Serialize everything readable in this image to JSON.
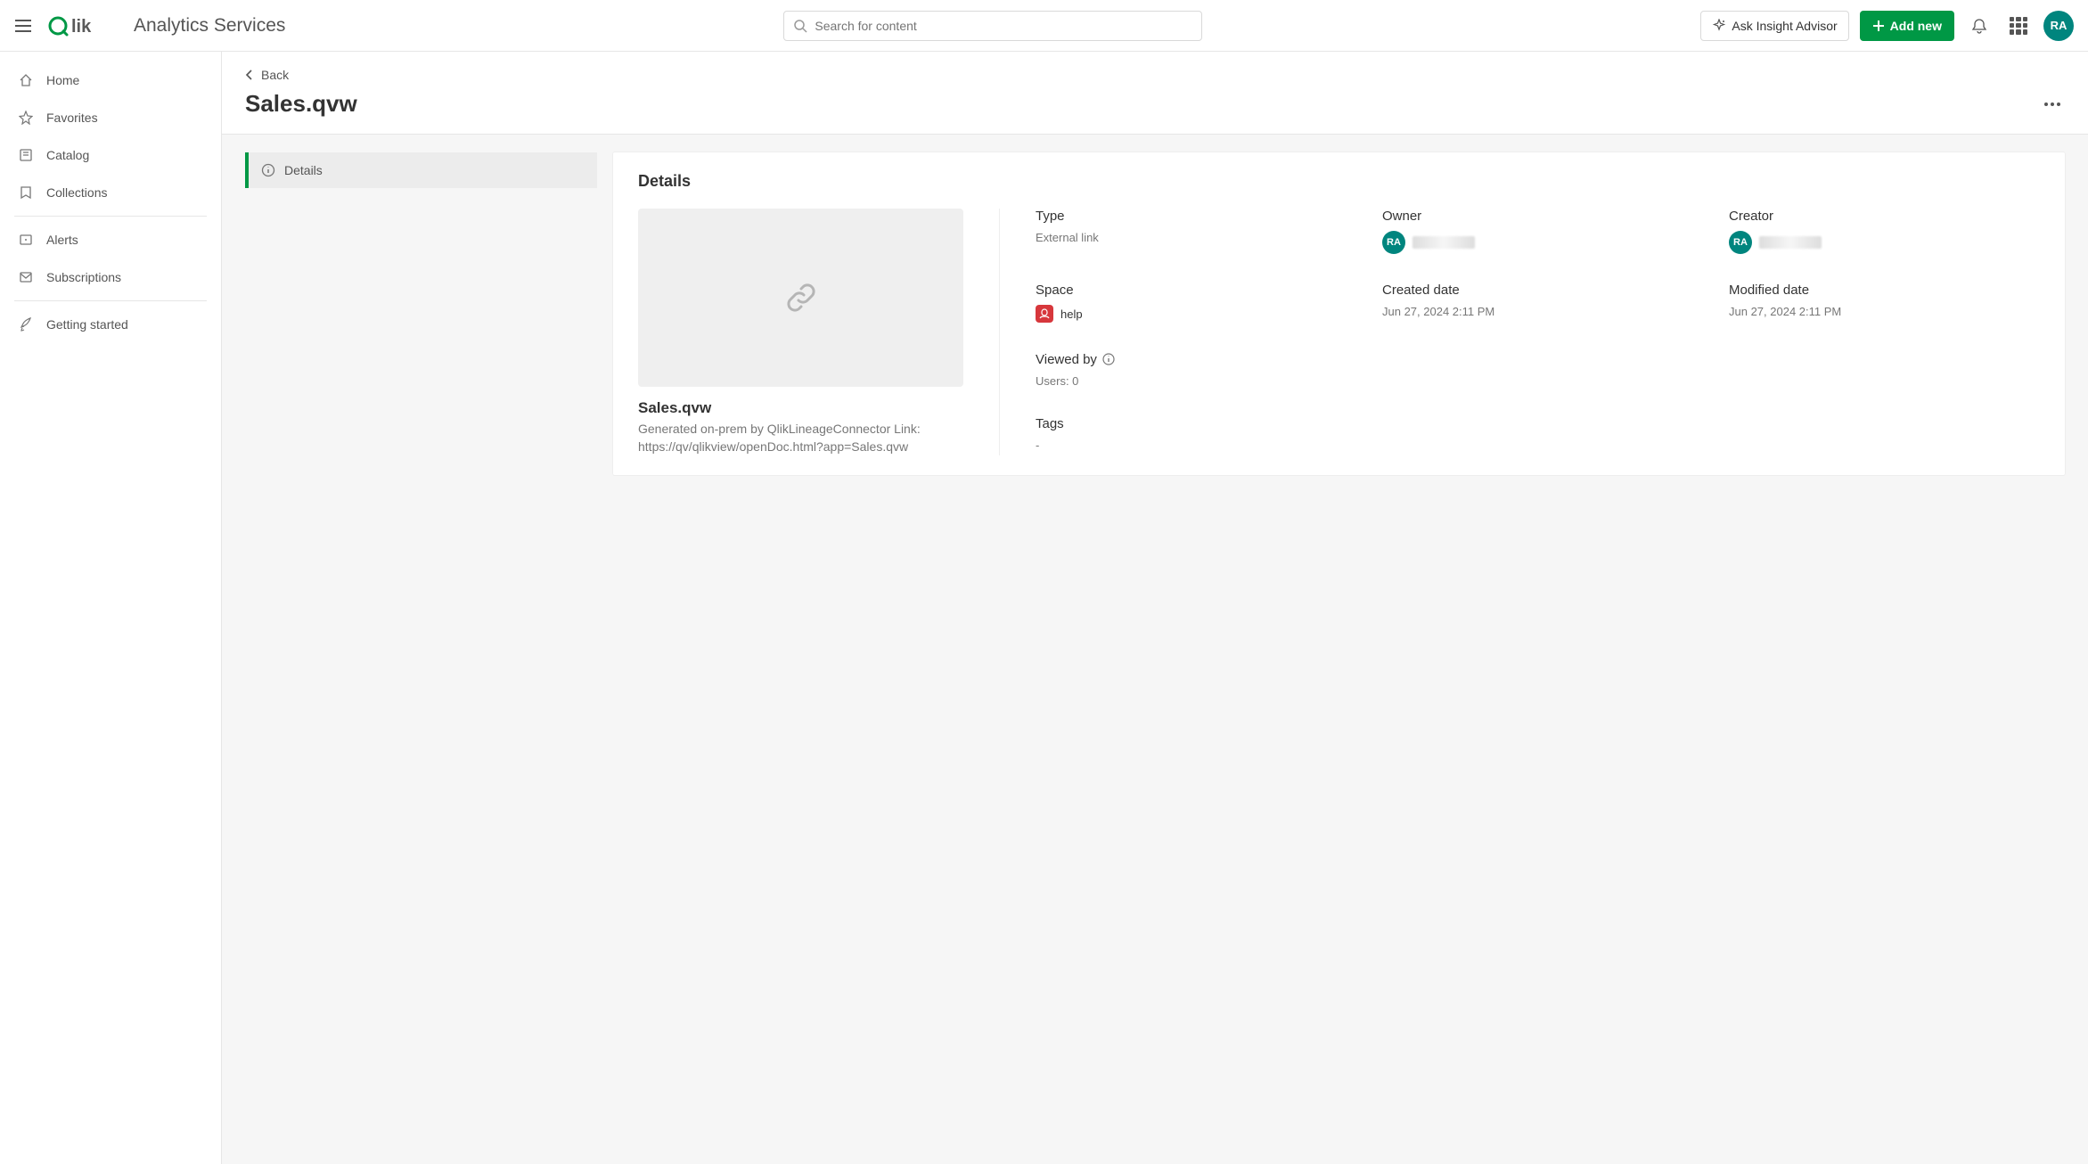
{
  "topbar": {
    "tenant_name": "Analytics Services",
    "search_placeholder": "Search for content",
    "ask_label": "Ask Insight Advisor",
    "add_new_label": "Add new",
    "avatar_initials": "RA"
  },
  "sidebar": {
    "items": [
      {
        "label": "Home",
        "icon": "home-icon"
      },
      {
        "label": "Favorites",
        "icon": "star-icon"
      },
      {
        "label": "Catalog",
        "icon": "catalog-icon"
      },
      {
        "label": "Collections",
        "icon": "collections-icon"
      },
      {
        "label": "Alerts",
        "icon": "alerts-icon"
      },
      {
        "label": "Subscriptions",
        "icon": "subscriptions-icon"
      },
      {
        "label": "Getting started",
        "icon": "rocket-icon"
      }
    ]
  },
  "page": {
    "back_label": "Back",
    "title": "Sales.qvw",
    "tab_details": "Details"
  },
  "details": {
    "heading": "Details",
    "asset_title": "Sales.qvw",
    "asset_description": "Generated on-prem by QlikLineageConnector Link: https://qv/qlikview/openDoc.html?app=Sales.qvw",
    "type_label": "Type",
    "type_value": "External link",
    "space_label": "Space",
    "space_value": "help",
    "viewed_by_label": "Viewed by",
    "viewed_by_value": "Users: 0",
    "tags_label": "Tags",
    "tags_value": "-",
    "owner_label": "Owner",
    "owner_initials": "RA",
    "creator_label": "Creator",
    "creator_initials": "RA",
    "created_label": "Created date",
    "created_value": "Jun 27, 2024 2:11 PM",
    "modified_label": "Modified date",
    "modified_value": "Jun 27, 2024 2:11 PM"
  }
}
